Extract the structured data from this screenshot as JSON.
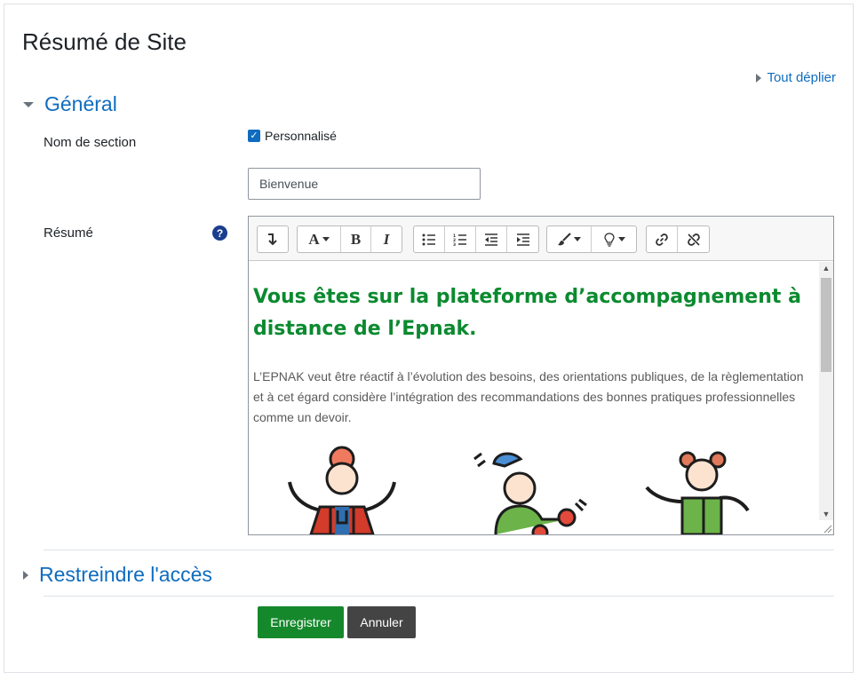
{
  "page": {
    "title": "Résumé de Site"
  },
  "expand_all_label": "Tout déplier",
  "sections": {
    "general": {
      "label": "Général",
      "expanded": true
    },
    "restrict": {
      "label": "Restreindre l'accès",
      "expanded": false
    }
  },
  "form": {
    "section_name_label": "Nom de section",
    "custom_checkbox": {
      "label": "Personnalisé",
      "checked": true
    },
    "section_name_value": "Bienvenue",
    "summary_label": "Résumé",
    "help_icon": "question-circle-icon"
  },
  "editor": {
    "toolbar_icons": [
      "collapse-arrow-icon",
      "font-style-icon",
      "bold-icon",
      "italic-icon",
      "bullet-list-icon",
      "numbered-list-icon",
      "outdent-icon",
      "indent-icon",
      "paint-brush-icon",
      "lightbulb-icon",
      "link-icon",
      "unlink-icon"
    ],
    "bold_glyph": "B",
    "italic_glyph": "I",
    "font_glyph": "A",
    "heading": "Vous êtes sur la plateforme d’accompagnement à distance de l’Epnak.",
    "paragraph": "L’EPNAK veut être réactif à l’évolution des besoins, des orientations publiques, de la règlementation et à cet égard considère l’intégration des recommandations des bonnes pratiques professionnelles comme un devoir.",
    "heading_color": "#0b8a2f"
  },
  "buttons": {
    "save": "Enregistrer",
    "cancel": "Annuler"
  },
  "colors": {
    "link": "#0f6cbf",
    "save_button": "#16882c",
    "cancel_button": "#444444"
  }
}
